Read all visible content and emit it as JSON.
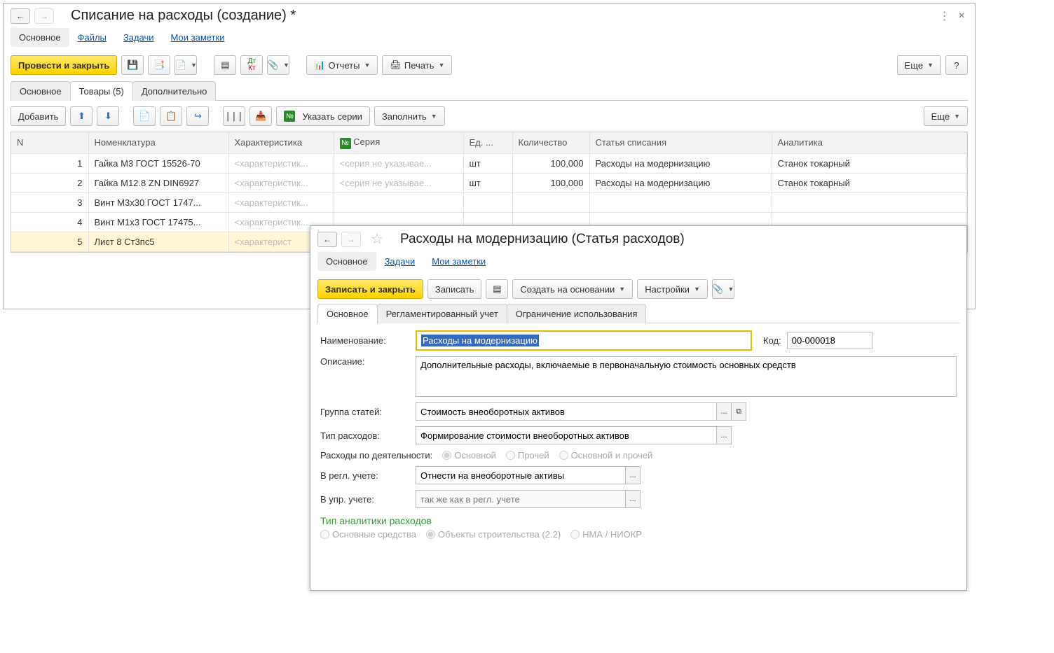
{
  "main": {
    "title": "Списание на расходы (создание) *",
    "linkTabs": {
      "active": "Основное",
      "files": "Файлы",
      "tasks": "Задачи",
      "notes": "Мои заметки"
    },
    "cmd": {
      "postClose": "Провести и закрыть",
      "reports": "Отчеты",
      "print": "Печать",
      "more": "Еще",
      "help": "?"
    },
    "tabs2": {
      "main": "Основное",
      "goods": "Товары (5)",
      "extra": "Дополнительно"
    },
    "tb2": {
      "add": "Добавить",
      "series": "Указать серии",
      "fill": "Заполнить",
      "more": "Еще"
    },
    "columns": {
      "n": "N",
      "nomen": "Номенклатура",
      "char": "Характеристика",
      "series": "Серия",
      "unit": "Ед. ...",
      "qty": "Количество",
      "article": "Статья списания",
      "analytics": "Аналитика"
    },
    "numPrefix": "№",
    "placeholders": {
      "char": "<характеристик...",
      "series": "<серия не указывае..."
    },
    "rows": [
      {
        "n": "1",
        "nomen": "Гайка М3 ГОСТ 15526-70",
        "char": "<характеристик...",
        "series": "<серия не указывае...",
        "unit": "шт",
        "qty": "100,000",
        "art": "Расходы на модернизацию",
        "ana": "Станок токарный"
      },
      {
        "n": "2",
        "nomen": "Гайка М12.8 ZN DIN6927",
        "char": "<характеристик...",
        "series": "<серия не указывае...",
        "unit": "шт",
        "qty": "100,000",
        "art": "Расходы на модернизацию",
        "ana": "Станок токарный"
      },
      {
        "n": "3",
        "nomen": "Винт М3х30 ГОСТ 1747...",
        "char": "<характеристик...",
        "series": "",
        "unit": "",
        "qty": "",
        "art": "",
        "ana": ""
      },
      {
        "n": "4",
        "nomen": "Винт М1х3 ГОСТ 17475...",
        "char": "<характеристик...",
        "series": "",
        "unit": "",
        "qty": "",
        "art": "",
        "ana": ""
      },
      {
        "n": "5",
        "nomen": "Лист 8 Ст3пс5",
        "char": "<характерист",
        "series": "",
        "unit": "",
        "qty": "",
        "art": "",
        "ana": ""
      }
    ]
  },
  "sub": {
    "title": "Расходы на модернизацию (Статья расходов)",
    "linkTabs": {
      "active": "Основное",
      "tasks": "Задачи",
      "notes": "Мои заметки"
    },
    "cmd": {
      "writeClose": "Записать и закрыть",
      "write": "Записать",
      "createBy": "Создать на основании",
      "settings": "Настройки"
    },
    "tabs2": {
      "main": "Основное",
      "reg": "Регламентированный учет",
      "limit": "Ограничение использования"
    },
    "f": {
      "nameLabel": "Наименование:",
      "nameValue": "Расходы на модернизацию",
      "codeLabel": "Код:",
      "codeValue": "00-000018",
      "descLabel": "Описание:",
      "descValue": "Дополнительные расходы, включаемые в первоначальную стоимость основных средств",
      "groupLabel": "Группа статей:",
      "groupValue": "Стоимость внеоборотных активов",
      "typeLabel": "Тип расходов:",
      "typeValue": "Формирование стоимости внеоборотных активов",
      "activityLabel": "Расходы по деятельности:",
      "activityOptions": {
        "main": "Основной",
        "other": "Прочей",
        "both": "Основной и прочей"
      },
      "reglLabel": "В регл. учете:",
      "reglValue": "Отнести на внеоборотные активы",
      "uprLabel": "В упр. учете:",
      "uprPlaceholder": "так же как в регл. учете",
      "anaHeader": "Тип аналитики расходов",
      "anaOptions": {
        "os": "Основные средства",
        "obj": "Объекты строительства (2.2)",
        "nma": "НМА / НИОКР"
      }
    }
  }
}
